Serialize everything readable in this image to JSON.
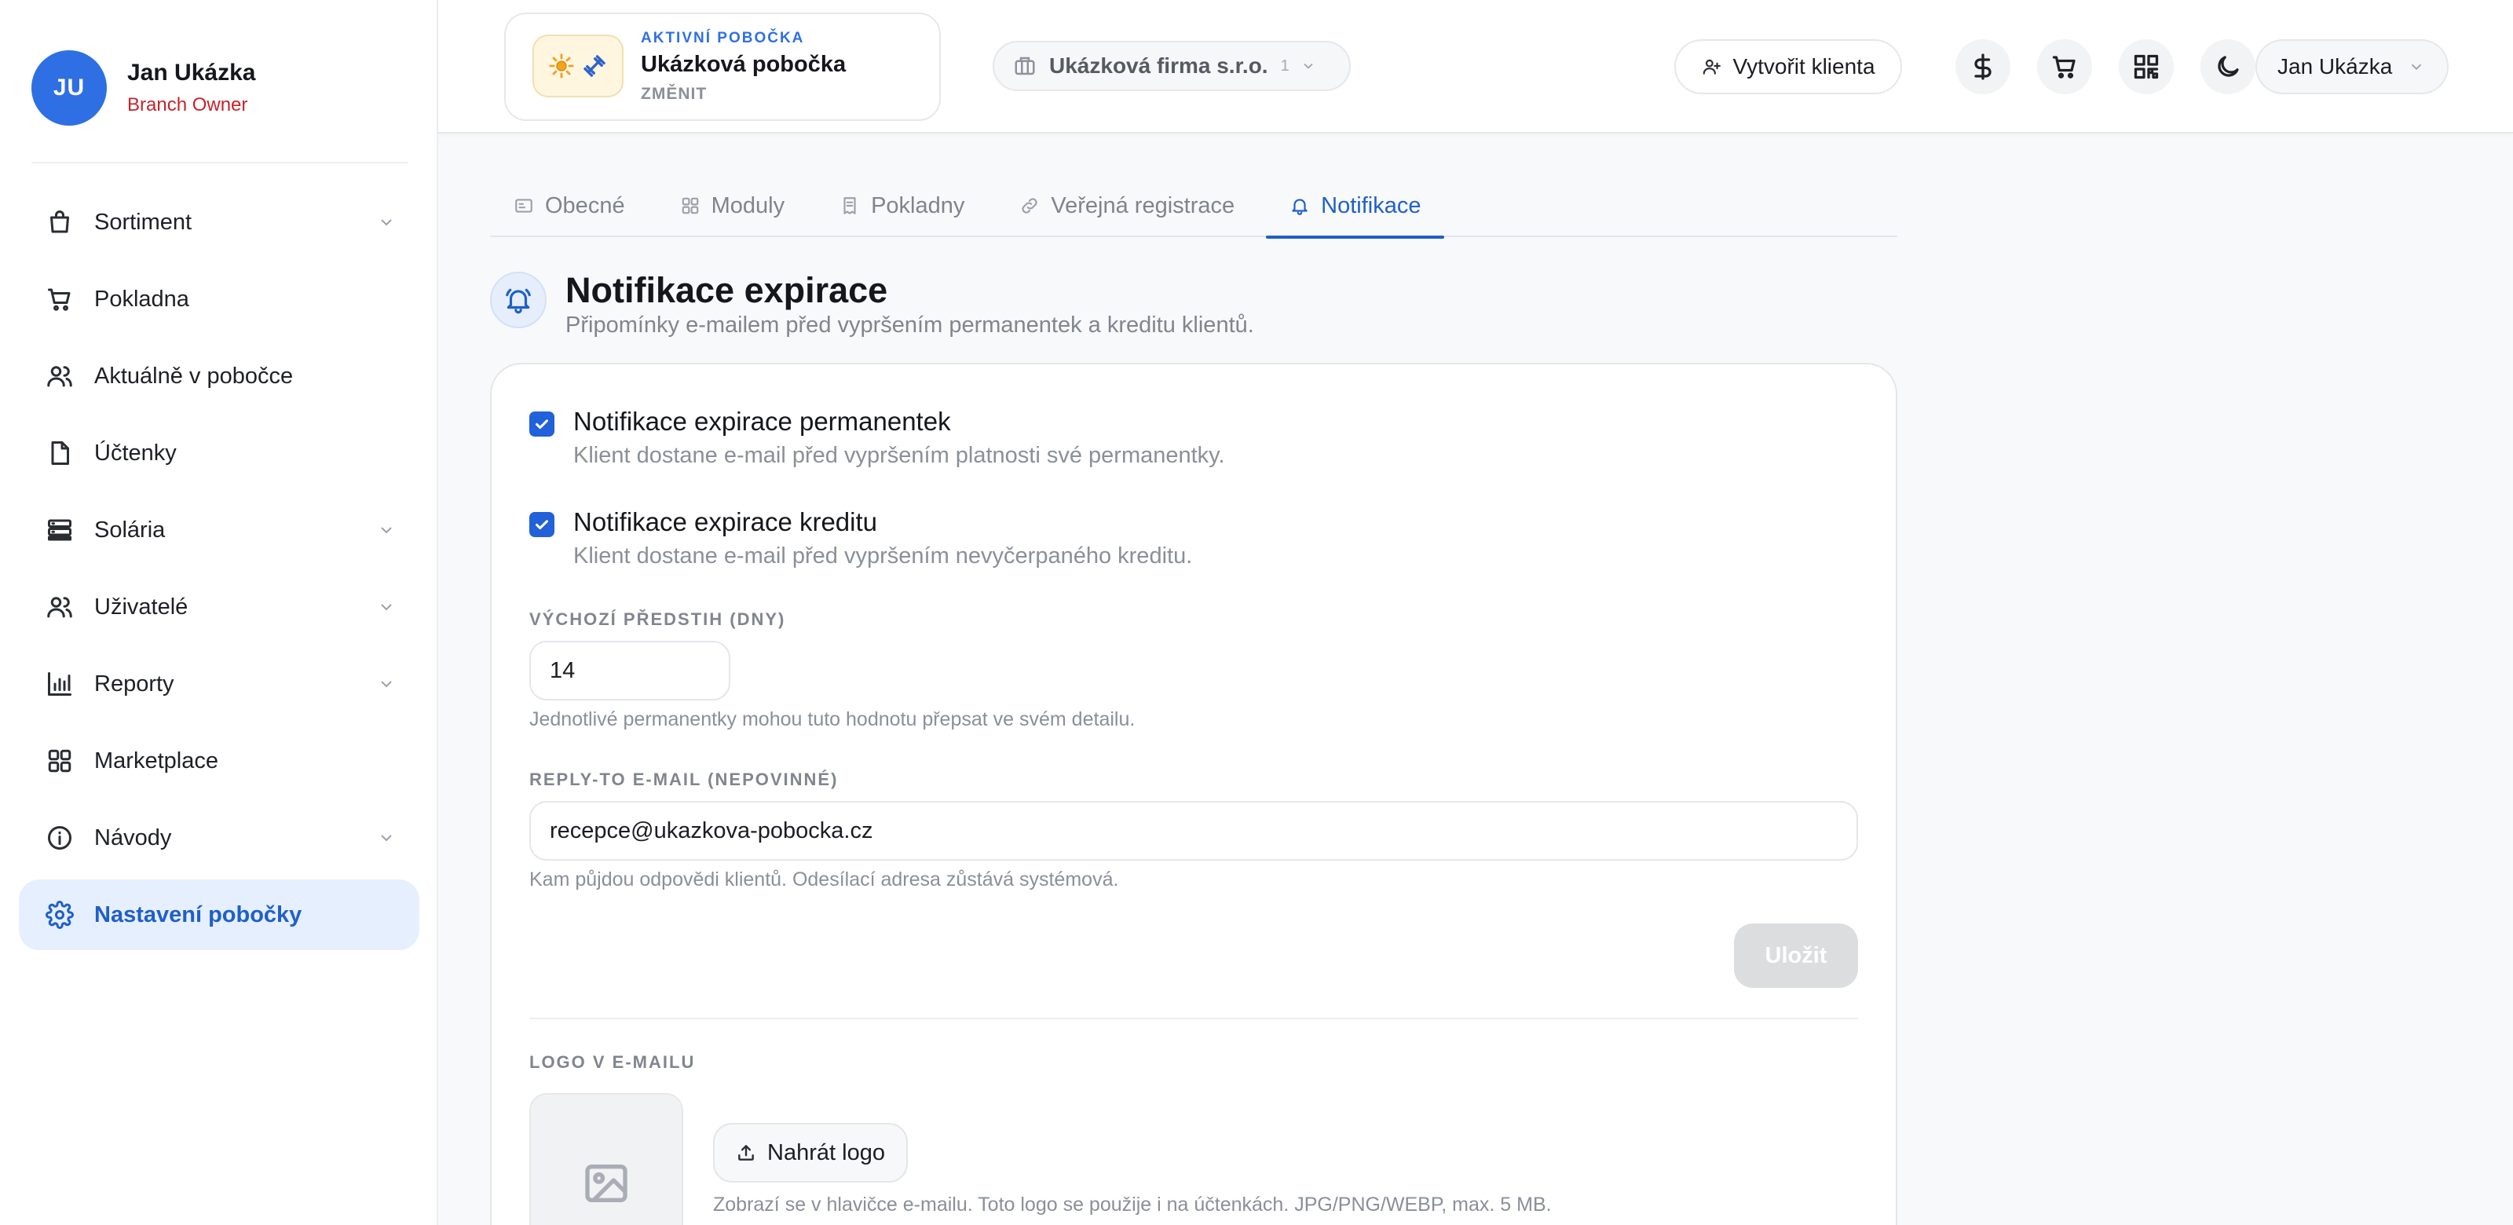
{
  "sidebar": {
    "avatar_initials": "JU",
    "user_name": "Jan Ukázka",
    "user_role": "Branch Owner",
    "items": [
      {
        "label": "Sortiment",
        "icon": "shopping-bag-icon",
        "has_chevron": true
      },
      {
        "label": "Pokladna",
        "icon": "cart-icon",
        "has_chevron": false
      },
      {
        "label": "Aktuálně v pobočce",
        "icon": "users-icon",
        "has_chevron": false
      },
      {
        "label": "Účtenky",
        "icon": "file-icon",
        "has_chevron": false
      },
      {
        "label": "Solária",
        "icon": "server-icon",
        "has_chevron": true
      },
      {
        "label": "Uživatelé",
        "icon": "users-icon",
        "has_chevron": true
      },
      {
        "label": "Reporty",
        "icon": "bar-chart-icon",
        "has_chevron": true
      },
      {
        "label": "Marketplace",
        "icon": "grid-icon",
        "has_chevron": false
      },
      {
        "label": "Návody",
        "icon": "info-icon",
        "has_chevron": true
      },
      {
        "label": "Nastavení pobočky",
        "icon": "gear-icon",
        "has_chevron": false,
        "active": true
      }
    ]
  },
  "header": {
    "branch": {
      "kicker": "AKTIVNÍ POBOČKA",
      "name": "Ukázková pobočka",
      "change_label": "ZMĚNIT"
    },
    "company": {
      "name": "Ukázková firma s.r.o.",
      "count": "1"
    },
    "create_client_label": "Vytvořit klienta",
    "user_menu_label": "Jan Ukázka"
  },
  "tabs": [
    {
      "label": "Obecné",
      "icon": "id-card-icon"
    },
    {
      "label": "Moduly",
      "icon": "grid-icon"
    },
    {
      "label": "Pokladny",
      "icon": "receipt-icon"
    },
    {
      "label": "Veřejná registrace",
      "icon": "link-icon"
    },
    {
      "label": "Notifikace",
      "icon": "bell-icon",
      "active": true
    }
  ],
  "section": {
    "title": "Notifikace expirace",
    "subtitle": "Připomínky e-mailem před vypršením permanentek a kreditu klientů."
  },
  "form": {
    "pass_notification": {
      "checked": true,
      "label": "Notifikace expirace permanentek",
      "description": "Klient dostane e-mail před vypršením platnosti své permanentky."
    },
    "credit_notification": {
      "checked": true,
      "label": "Notifikace expirace kreditu",
      "description": "Klient dostane e-mail před vypršením nevyčerpaného kreditu."
    },
    "advance_days": {
      "label": "VÝCHOZÍ PŘEDSTIH (DNY)",
      "value": "14",
      "help": "Jednotlivé permanentky mohou tuto hodnotu přepsat ve svém detailu."
    },
    "reply_to": {
      "label": "REPLY-TO E-MAIL (NEPOVINNÉ)",
      "value": "recepce@ukazkova-pobocka.cz",
      "help": "Kam půjdou odpovědi klientů. Odesílací adresa zůstává systémová."
    },
    "save_label": "Uložit",
    "email_logo": {
      "label": "LOGO V E-MAILU",
      "upload_label": "Nahrát logo",
      "help": "Zobrazí se v hlavičce e-mailu. Toto logo se použije i na účtenkách. JPG/PNG/WEBP, max. 5 MB."
    }
  },
  "colors": {
    "accent": "#1f5fc9",
    "avatar": "#2f6fe4",
    "role": "#c8232c",
    "checkbox": "#2161d9"
  }
}
